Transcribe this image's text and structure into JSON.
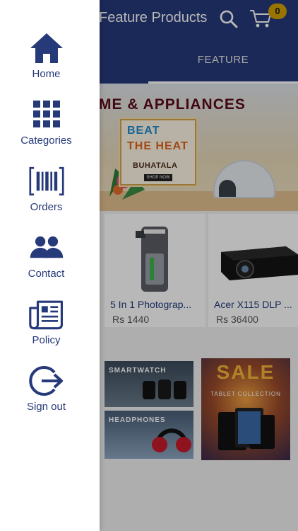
{
  "header": {
    "title": "Feature Products",
    "cart_count": "0",
    "tab_label": "FEATURE"
  },
  "banner": {
    "headline": "ME & APPLIANCES",
    "promo_line1": "BEAT",
    "promo_line2": "THE HEAT",
    "promo_line3": "BUHATALA",
    "promo_button": "SHOP NOW"
  },
  "products": [
    {
      "name": "5 In 1 Photograp...",
      "price": "Rs 1440"
    },
    {
      "name": "Acer X115 DLP ...",
      "price": "Rs 36400"
    }
  ],
  "promos": {
    "smartwatch": "SMARTWATCH",
    "headphones": "HEADPHONES",
    "sale_title": "SALE",
    "sale_sub": "TABLET COLLECTION"
  },
  "drawer": {
    "items": [
      {
        "label": "Home",
        "icon": "home-icon"
      },
      {
        "label": "Categories",
        "icon": "grid-icon"
      },
      {
        "label": "Orders",
        "icon": "barcode-icon"
      },
      {
        "label": "Contact",
        "icon": "people-icon"
      },
      {
        "label": "Policy",
        "icon": "document-icon"
      },
      {
        "label": "Sign out",
        "icon": "logout-icon"
      }
    ]
  },
  "colors": {
    "primary": "#263a7a",
    "badge": "#d4a200"
  }
}
